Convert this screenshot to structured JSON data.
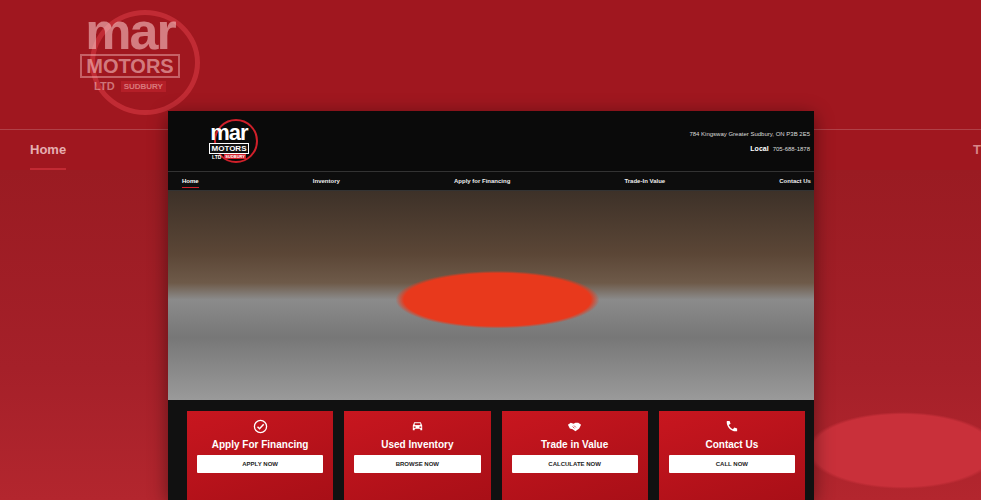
{
  "backdrop": {
    "logo": {
      "name": "mar",
      "brand": "MOTORS",
      "suffix": "LTD",
      "city": "SUDBURY"
    },
    "nav": [
      {
        "label": "Home",
        "selected": true
      },
      {
        "label": "T",
        "selected": false
      }
    ]
  },
  "site": {
    "logo": {
      "name": "mar",
      "brand": "MOTORS",
      "suffix": "LTD",
      "city": "SUDBURY"
    },
    "address": "784 Kingsway Greater Sudbury, ON P3B 2E5",
    "phone": {
      "label": "Local",
      "number": "705-688-1878"
    },
    "nav": [
      {
        "label": "Home",
        "selected": true
      },
      {
        "label": "Inventory",
        "selected": false
      },
      {
        "label": "Apply for Financing",
        "selected": false
      },
      {
        "label": "Trade-In Value",
        "selected": false
      },
      {
        "label": "Contact Us",
        "selected": false
      }
    ],
    "cards": [
      {
        "title": "Apply For Financing",
        "button": "APPLY NOW"
      },
      {
        "title": "Used Inventory",
        "button": "BROWSE NOW"
      },
      {
        "title": "Trade in Value",
        "button": "CALCULATE NOW"
      },
      {
        "title": "Contact Us",
        "button": "CALL NOW"
      }
    ]
  }
}
